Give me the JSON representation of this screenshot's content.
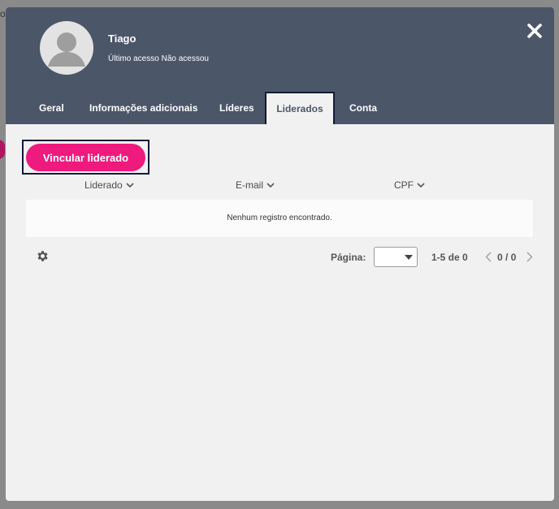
{
  "background": {
    "fragment_text": "os"
  },
  "modal": {
    "user": {
      "name": "Tiago",
      "last_access_label": "Último acesso",
      "last_access_value": "Não acessou"
    },
    "tabs": [
      {
        "label": "Geral",
        "active": false
      },
      {
        "label": "Informações adicionais",
        "active": false
      },
      {
        "label": "Líderes",
        "active": false
      },
      {
        "label": "Liderados",
        "active": true
      },
      {
        "label": "Conta",
        "active": false
      }
    ],
    "actions": {
      "link_label": "Vincular liderado"
    },
    "table": {
      "columns": [
        "Liderado",
        "E-mail",
        "CPF"
      ],
      "empty_message": "Nenhum registro encontrado."
    },
    "pagination": {
      "page_label": "Página:",
      "selected_page": "",
      "range": "1-5 de 0",
      "page_count": "0 / 0"
    }
  },
  "colors": {
    "header": "#4b5669",
    "accent": "#ee1a7e",
    "highlight_outline": "#141b38"
  },
  "icons": [
    "user-avatar-icon",
    "close-icon",
    "chevron-down-icon",
    "gear-icon",
    "chevron-left-icon",
    "chevron-right-icon"
  ]
}
